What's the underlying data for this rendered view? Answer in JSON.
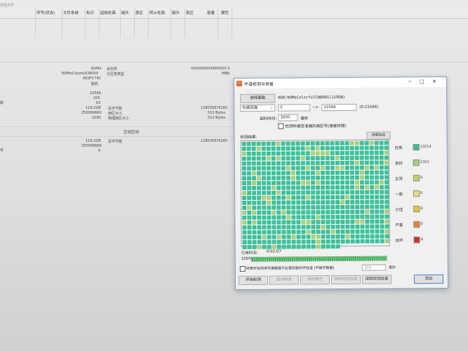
{
  "background": {
    "header_text": "浏览文件",
    "columns": [
      "序号(状态)",
      "文件系统",
      "标识",
      "起始柱面",
      "磁头",
      "扇区",
      "终止柱面",
      "磁头",
      "扇区",
      "容量",
      "属性"
    ],
    "disk_model": "NVMe",
    "disk_name": "NVMeColorfulCN600I",
    "disk_serial": "A50FC74C",
    "disk_status": "脱机",
    "serial_label": "序列号",
    "serial_value": "0000000000000000 0",
    "partition_type_label": "分区表类型",
    "partition_type_value": "MBR",
    "cylinders": "15566",
    "heads": "255",
    "sectors": "63",
    "capacity": "119.2GB",
    "total_sectors": "250069680",
    "extra": "1090",
    "total_bytes_label": "总字节数",
    "total_bytes_value": "128035676160",
    "sector_size_label": "扇区大小",
    "sector_size_value": "512 Bytes",
    "phys_sector_label": "物理扇区大小",
    "phys_sector_value": "512 Bytes",
    "free_space_label": "空闲空间",
    "free_capacity": "119.2GB",
    "free_sectors": "250069680",
    "free_zero": "0",
    "free_total_bytes_label": "总字节数",
    "free_total_bytes_value": "128035676160",
    "left_frag_1": "数",
    "left_frag_2": "号"
  },
  "dialog": {
    "title": "坏道检测与修复",
    "select_disk_button": "选择硬盘",
    "disk_label": "HD0:NVMeColorfulCN600I(119GB)",
    "range_select": "柱面范围",
    "range_start": "0",
    "range_arrow": "-->",
    "range_end": "15566",
    "range_note": "(0-15566)",
    "timeout_label": "超时时间：",
    "timeout_value": "3000",
    "timeout_unit": "毫秒",
    "report_checkbox_label": "检测时报告准确的扇区号(速度较慢)",
    "result_label": "检测结果：",
    "detail_button": "详细信息",
    "legend": [
      {
        "label": "优秀",
        "color": "#3dbf9a",
        "count": "13214"
      },
      {
        "label": "良好",
        "color": "#a9cf7e",
        "count": "2353"
      },
      {
        "label": "正常",
        "color": "#c2d864",
        "count": "0"
      },
      {
        "label": "一般",
        "color": "#e3e08a",
        "count": "0"
      },
      {
        "label": "欠佳",
        "color": "#e9c53a",
        "count": "0"
      },
      {
        "label": "严重",
        "color": "#e6822d",
        "count": "0"
      },
      {
        "label": "损坏",
        "color": "#e02a2a",
        "count": "0"
      }
    ],
    "elapsed_label": "已用时间：",
    "elapsed_value": "0:02:07",
    "progress_percent_text": "100%",
    "progress": 1.0,
    "repair_checkbox_label": "修复时包括读写速度慢于此毫秒数的坏柱道 (不破坏数据)",
    "repair_threshold": "320",
    "repair_unit": "毫秒",
    "buttons": {
      "start": "开始检测",
      "try_repair": "尝试修复",
      "save_report": "保存报告",
      "save_info": "保存检测信息",
      "load_info": "读取检测信息",
      "exit": "退出"
    }
  }
}
